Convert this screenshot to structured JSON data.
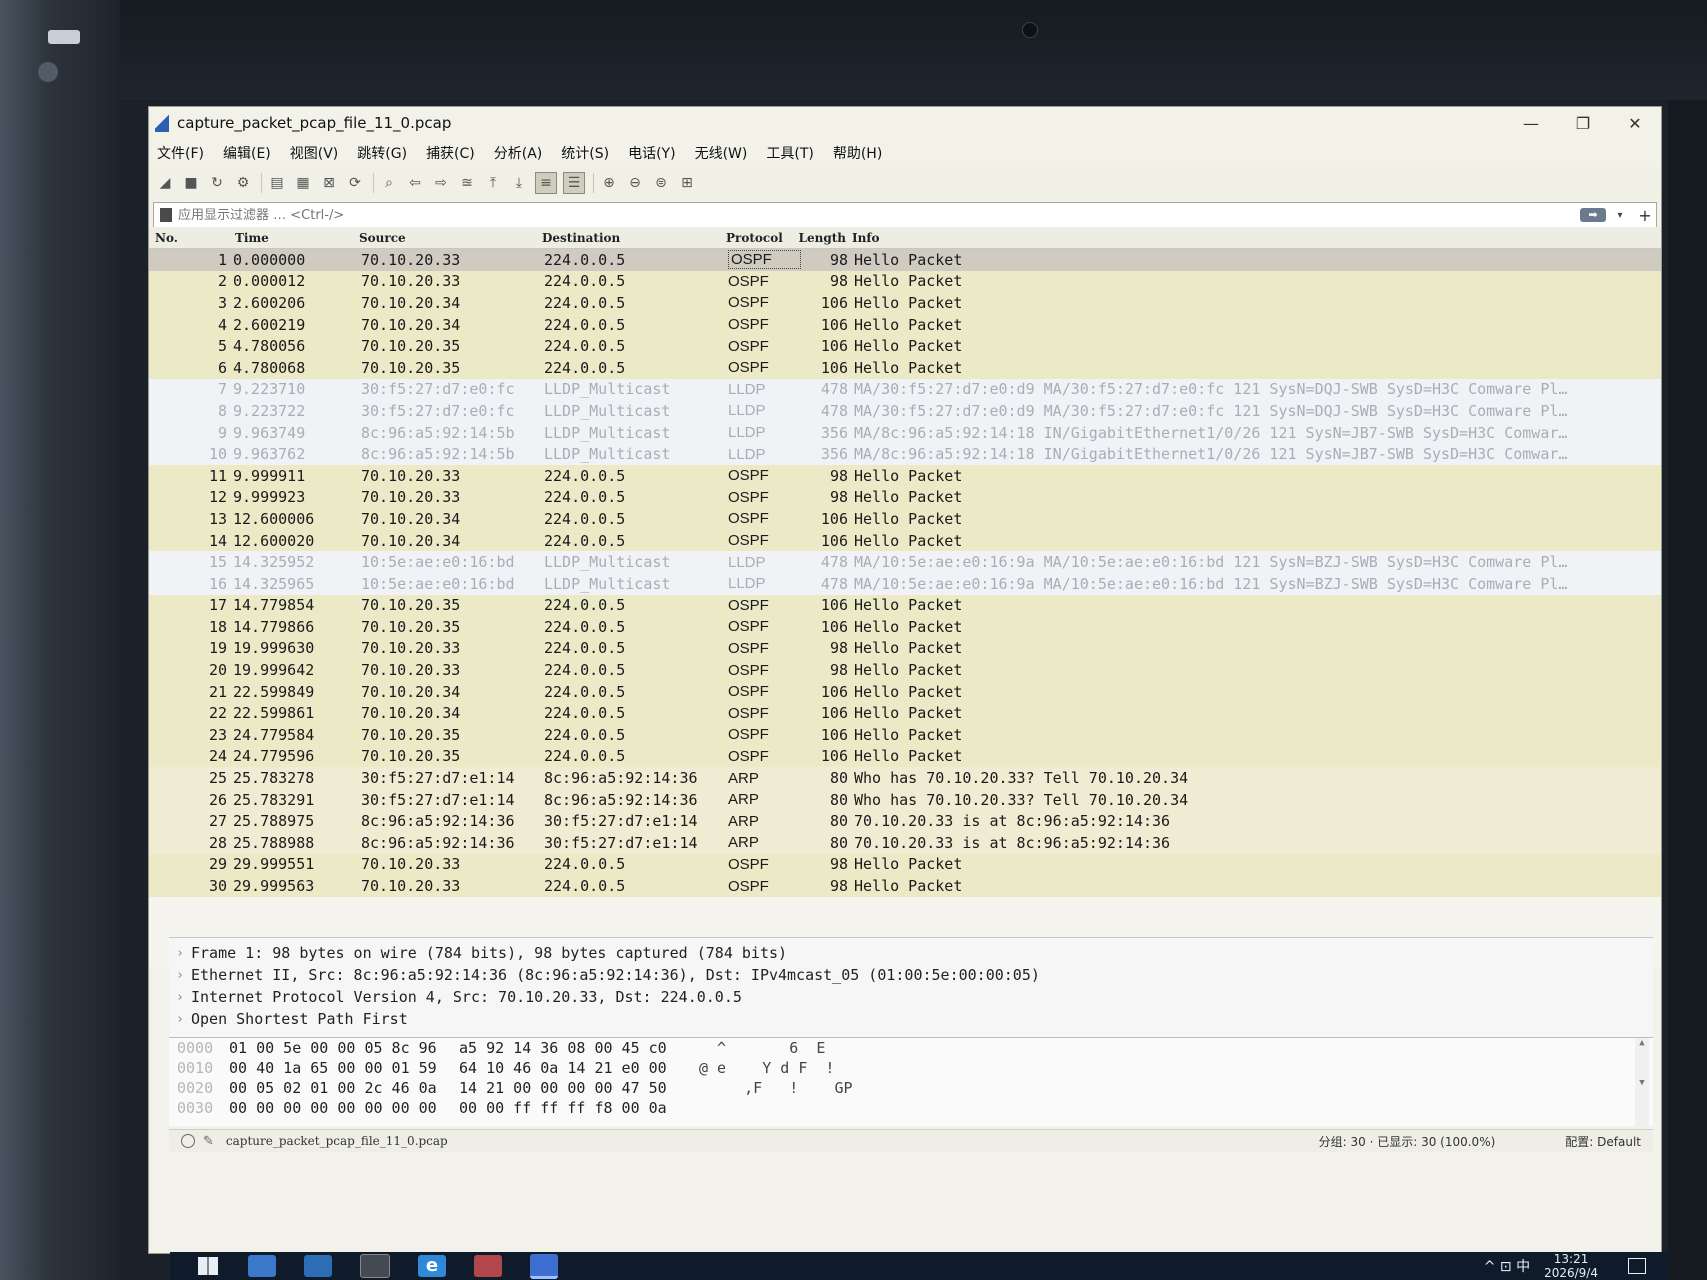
{
  "window": {
    "title": "capture_packet_pcap_file_11_0.pcap",
    "minimize": "—",
    "restore": "❐",
    "close": "✕"
  },
  "menubar": [
    "文件(F)",
    "编辑(E)",
    "视图(V)",
    "跳转(G)",
    "捕获(C)",
    "分析(A)",
    "统计(S)",
    "电话(Y)",
    "无线(W)",
    "工具(T)",
    "帮助(H)"
  ],
  "filter": {
    "placeholder": "应用显示过滤器 … <Ctrl-/>",
    "apply_icon": "arrow-right-icon",
    "add_label": "+"
  },
  "columns": {
    "no": "No.",
    "time": "Time",
    "source": "Source",
    "destination": "Destination",
    "protocol": "Protocol",
    "length": "Length",
    "info": "Info"
  },
  "packets": [
    {
      "no": "1",
      "time": "0.000000",
      "src": "70.10.20.33",
      "dst": "224.0.0.5",
      "proto": "OSPF",
      "len": "98",
      "info": "Hello Packet"
    },
    {
      "no": "2",
      "time": "0.000012",
      "src": "70.10.20.33",
      "dst": "224.0.0.5",
      "proto": "OSPF",
      "len": "98",
      "info": "Hello Packet"
    },
    {
      "no": "3",
      "time": "2.600206",
      "src": "70.10.20.34",
      "dst": "224.0.0.5",
      "proto": "OSPF",
      "len": "106",
      "info": "Hello Packet"
    },
    {
      "no": "4",
      "time": "2.600219",
      "src": "70.10.20.34",
      "dst": "224.0.0.5",
      "proto": "OSPF",
      "len": "106",
      "info": "Hello Packet"
    },
    {
      "no": "5",
      "time": "4.780056",
      "src": "70.10.20.35",
      "dst": "224.0.0.5",
      "proto": "OSPF",
      "len": "106",
      "info": "Hello Packet"
    },
    {
      "no": "6",
      "time": "4.780068",
      "src": "70.10.20.35",
      "dst": "224.0.0.5",
      "proto": "OSPF",
      "len": "106",
      "info": "Hello Packet"
    },
    {
      "no": "7",
      "time": "9.223710",
      "src": "30:f5:27:d7:e0:fc",
      "dst": "LLDP_Multicast",
      "proto": "LLDP",
      "len": "478",
      "info": "MA/30:f5:27:d7:e0:d9 MA/30:f5:27:d7:e0:fc 121 SysN=DQJ-SWB SysD=H3C Comware Pl…"
    },
    {
      "no": "8",
      "time": "9.223722",
      "src": "30:f5:27:d7:e0:fc",
      "dst": "LLDP_Multicast",
      "proto": "LLDP",
      "len": "478",
      "info": "MA/30:f5:27:d7:e0:d9 MA/30:f5:27:d7:e0:fc 121 SysN=DQJ-SWB SysD=H3C Comware Pl…"
    },
    {
      "no": "9",
      "time": "9.963749",
      "src": "8c:96:a5:92:14:5b",
      "dst": "LLDP_Multicast",
      "proto": "LLDP",
      "len": "356",
      "info": "MA/8c:96:a5:92:14:18 IN/GigabitEthernet1/0/26 121 SysN=JB7-SWB SysD=H3C Comwar…"
    },
    {
      "no": "10",
      "time": "9.963762",
      "src": "8c:96:a5:92:14:5b",
      "dst": "LLDP_Multicast",
      "proto": "LLDP",
      "len": "356",
      "info": "MA/8c:96:a5:92:14:18 IN/GigabitEthernet1/0/26 121 SysN=JB7-SWB SysD=H3C Comwar…"
    },
    {
      "no": "11",
      "time": "9.999911",
      "src": "70.10.20.33",
      "dst": "224.0.0.5",
      "proto": "OSPF",
      "len": "98",
      "info": "Hello Packet"
    },
    {
      "no": "12",
      "time": "9.999923",
      "src": "70.10.20.33",
      "dst": "224.0.0.5",
      "proto": "OSPF",
      "len": "98",
      "info": "Hello Packet"
    },
    {
      "no": "13",
      "time": "12.600006",
      "src": "70.10.20.34",
      "dst": "224.0.0.5",
      "proto": "OSPF",
      "len": "106",
      "info": "Hello Packet"
    },
    {
      "no": "14",
      "time": "12.600020",
      "src": "70.10.20.34",
      "dst": "224.0.0.5",
      "proto": "OSPF",
      "len": "106",
      "info": "Hello Packet"
    },
    {
      "no": "15",
      "time": "14.325952",
      "src": "10:5e:ae:e0:16:bd",
      "dst": "LLDP_Multicast",
      "proto": "LLDP",
      "len": "478",
      "info": "MA/10:5e:ae:e0:16:9a MA/10:5e:ae:e0:16:bd 121 SysN=BZJ-SWB SysD=H3C Comware Pl…"
    },
    {
      "no": "16",
      "time": "14.325965",
      "src": "10:5e:ae:e0:16:bd",
      "dst": "LLDP_Multicast",
      "proto": "LLDP",
      "len": "478",
      "info": "MA/10:5e:ae:e0:16:9a MA/10:5e:ae:e0:16:bd 121 SysN=BZJ-SWB SysD=H3C Comware Pl…"
    },
    {
      "no": "17",
      "time": "14.779854",
      "src": "70.10.20.35",
      "dst": "224.0.0.5",
      "proto": "OSPF",
      "len": "106",
      "info": "Hello Packet"
    },
    {
      "no": "18",
      "time": "14.779866",
      "src": "70.10.20.35",
      "dst": "224.0.0.5",
      "proto": "OSPF",
      "len": "106",
      "info": "Hello Packet"
    },
    {
      "no": "19",
      "time": "19.999630",
      "src": "70.10.20.33",
      "dst": "224.0.0.5",
      "proto": "OSPF",
      "len": "98",
      "info": "Hello Packet"
    },
    {
      "no": "20",
      "time": "19.999642",
      "src": "70.10.20.33",
      "dst": "224.0.0.5",
      "proto": "OSPF",
      "len": "98",
      "info": "Hello Packet"
    },
    {
      "no": "21",
      "time": "22.599849",
      "src": "70.10.20.34",
      "dst": "224.0.0.5",
      "proto": "OSPF",
      "len": "106",
      "info": "Hello Packet"
    },
    {
      "no": "22",
      "time": "22.599861",
      "src": "70.10.20.34",
      "dst": "224.0.0.5",
      "proto": "OSPF",
      "len": "106",
      "info": "Hello Packet"
    },
    {
      "no": "23",
      "time": "24.779584",
      "src": "70.10.20.35",
      "dst": "224.0.0.5",
      "proto": "OSPF",
      "len": "106",
      "info": "Hello Packet"
    },
    {
      "no": "24",
      "time": "24.779596",
      "src": "70.10.20.35",
      "dst": "224.0.0.5",
      "proto": "OSPF",
      "len": "106",
      "info": "Hello Packet"
    },
    {
      "no": "25",
      "time": "25.783278",
      "src": "30:f5:27:d7:e1:14",
      "dst": "8c:96:a5:92:14:36",
      "proto": "ARP",
      "len": "80",
      "info": "Who has 70.10.20.33? Tell 70.10.20.34"
    },
    {
      "no": "26",
      "time": "25.783291",
      "src": "30:f5:27:d7:e1:14",
      "dst": "8c:96:a5:92:14:36",
      "proto": "ARP",
      "len": "80",
      "info": "Who has 70.10.20.33? Tell 70.10.20.34"
    },
    {
      "no": "27",
      "time": "25.788975",
      "src": "8c:96:a5:92:14:36",
      "dst": "30:f5:27:d7:e1:14",
      "proto": "ARP",
      "len": "80",
      "info": "70.10.20.33 is at 8c:96:a5:92:14:36"
    },
    {
      "no": "28",
      "time": "25.788988",
      "src": "8c:96:a5:92:14:36",
      "dst": "30:f5:27:d7:e1:14",
      "proto": "ARP",
      "len": "80",
      "info": "70.10.20.33 is at 8c:96:a5:92:14:36"
    },
    {
      "no": "29",
      "time": "29.999551",
      "src": "70.10.20.33",
      "dst": "224.0.0.5",
      "proto": "OSPF",
      "len": "98",
      "info": "Hello Packet"
    },
    {
      "no": "30",
      "time": "29.999563",
      "src": "70.10.20.33",
      "dst": "224.0.0.5",
      "proto": "OSPF",
      "len": "98",
      "info": "Hello Packet"
    }
  ],
  "selected_packet": "1",
  "details": [
    "Frame 1: 98 bytes on wire (784 bits), 98 bytes captured (784 bits)",
    "Ethernet II, Src: 8c:96:a5:92:14:36 (8c:96:a5:92:14:36), Dst: IPv4mcast_05 (01:00:5e:00:00:05)",
    "Internet Protocol Version 4, Src: 70.10.20.33, Dst: 224.0.0.5",
    "Open Shortest Path First"
  ],
  "bytes": [
    {
      "offset": "0000",
      "hex1": "01 00 5e 00 00 05 8c 96",
      "hex2": "a5 92 14 36 08 00 45 c0",
      "ascii": "  ^       6  E"
    },
    {
      "offset": "0010",
      "hex1": "00 40 1a 65 00 00 01 59",
      "hex2": "64 10 46 0a 14 21 e0 00",
      "ascii": "@ e    Y d F  !"
    },
    {
      "offset": "0020",
      "hex1": "00 05 02 01 00 2c 46 0a",
      "hex2": "14 21 00 00 00 00 47 50",
      "ascii": "     ,F   !    GP"
    },
    {
      "offset": "0030",
      "hex1": "00 00 00 00 00 00 00 00",
      "hex2": "00 00 ff ff ff f8 00 0a",
      "ascii": ""
    }
  ],
  "status": {
    "file": "capture_packet_pcap_file_11_0.pcap",
    "packets": "分组: 30 · 已显示: 30 (100.0%)",
    "profile": "配置: Default"
  },
  "taskbar": {
    "tray": "^ ⊡ 中",
    "time": "13:21",
    "date": "2026/9/4"
  },
  "colors": {
    "ospf_row": "#ece9c7",
    "lldp_row": "#f1f2f5",
    "arp_row": "#efecd3",
    "selected_row": "#cfcbc1"
  }
}
